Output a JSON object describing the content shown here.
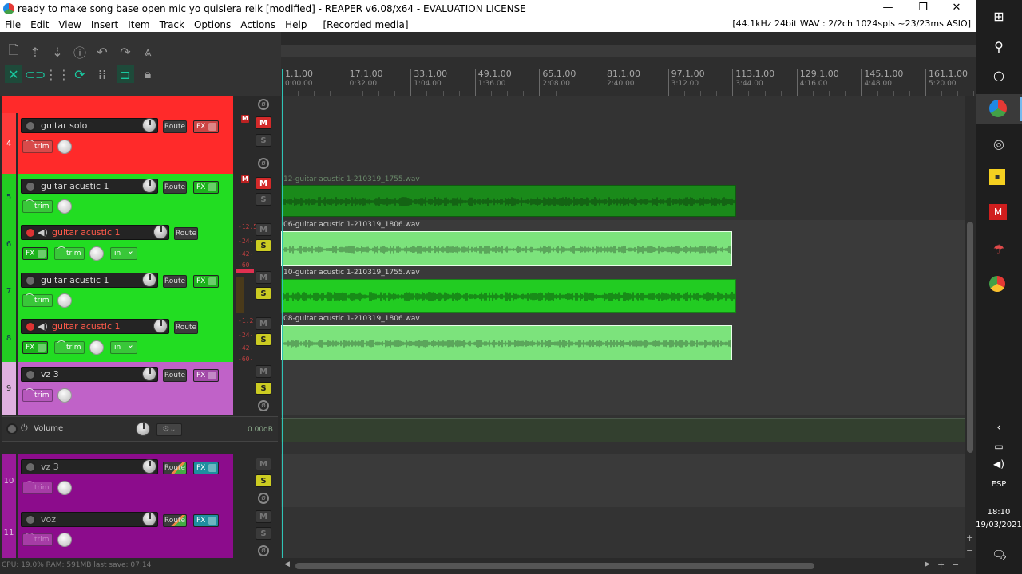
{
  "window": {
    "title": "ready to make song  base open mic yo quisiera reik [modified] - REAPER v6.08/x64 - EVALUATION LICENSE",
    "minimize": "—",
    "maximize": "❐",
    "close": "✕"
  },
  "menu": {
    "items": [
      "File",
      "Edit",
      "View",
      "Insert",
      "Item",
      "Track",
      "Options",
      "Actions",
      "Help",
      "[Recorded media]"
    ],
    "status": "[44.1kHz 24bit WAV : 2/2ch 1024spls ~23/23ms ASIO]"
  },
  "toolbar": {
    "row1": [
      "new-project-icon",
      "upload-icon",
      "download-icon",
      "info-icon",
      "undo-icon",
      "redo-icon",
      "metronome-icon"
    ],
    "row2": [
      "ripple-icon",
      "link-icon",
      "grid-icon",
      "snap-icon",
      "dots-icon",
      "loop-icon",
      "lock-icon"
    ]
  },
  "ruler": {
    "markers": [
      {
        "bar": "1.1.00",
        "time": "0:00.00"
      },
      {
        "bar": "17.1.00",
        "time": "0:32.00"
      },
      {
        "bar": "33.1.00",
        "time": "1:04.00"
      },
      {
        "bar": "49.1.00",
        "time": "1:36.00"
      },
      {
        "bar": "65.1.00",
        "time": "2:08.00"
      },
      {
        "bar": "81.1.00",
        "time": "2:40.00"
      },
      {
        "bar": "97.1.00",
        "time": "3:12.00"
      },
      {
        "bar": "113.1.00",
        "time": "3:44.00"
      },
      {
        "bar": "129.1.00",
        "time": "4:16.00"
      },
      {
        "bar": "145.1.00",
        "time": "4:48.00"
      },
      {
        "bar": "161.1.00",
        "time": "5:20.00"
      }
    ]
  },
  "tracks": [
    {
      "num": "4",
      "name": "guitar solo",
      "color": "#ff2a2a",
      "numColor": "#ff3a3a"
    },
    {
      "num": "5",
      "name": "guitar acustic 1",
      "color": "#22dd22",
      "numColor": "#22cc22"
    },
    {
      "num": "6",
      "name": "guitar acustic 1",
      "color": "#22dd22",
      "numColor": "#22cc22"
    },
    {
      "num": "7",
      "name": "guitar acustic 1",
      "color": "#22dd22",
      "numColor": "#22cc22"
    },
    {
      "num": "8",
      "name": "guitar acustic 1",
      "color": "#22dd22",
      "numColor": "#22cc22"
    },
    {
      "num": "9",
      "name": "vz 3",
      "color": "#c062c8",
      "numColor": "#d89ad8"
    },
    {
      "num": "10",
      "name": "vz 3",
      "color": "#8c0c8c",
      "numColor": "#9a1a9a"
    },
    {
      "num": "11",
      "name": "voz",
      "color": "#8c0c8c",
      "numColor": "#9a1a9a"
    }
  ],
  "labels": {
    "route": "Route",
    "fx": "FX",
    "trim": "trim",
    "in": "in",
    "m": "M",
    "s": "S"
  },
  "meters": {
    "track6": [
      "-12.5",
      "-24-",
      "-42-",
      "-60-"
    ],
    "track8": [
      "-1.2",
      "-24-",
      "-42-",
      "-60-"
    ]
  },
  "master": {
    "label": "Volume",
    "db": "0.00dB"
  },
  "items": [
    {
      "name": "12-guitar acustic 1-210319_1755.wav"
    },
    {
      "name": "06-guitar acustic 1-210319_1806.wav"
    },
    {
      "name": "10-guitar acustic 1-210319_1755.wav"
    },
    {
      "name": "08-guitar acustic 1-210319_1806.wav"
    }
  ],
  "status": {
    "text": "CPU: 19.0% RAM: 591MB last save: 07:14"
  },
  "taskbar": {
    "lang": "ESP",
    "time": "18:10",
    "date": "19/03/2021",
    "notifications": "2"
  }
}
